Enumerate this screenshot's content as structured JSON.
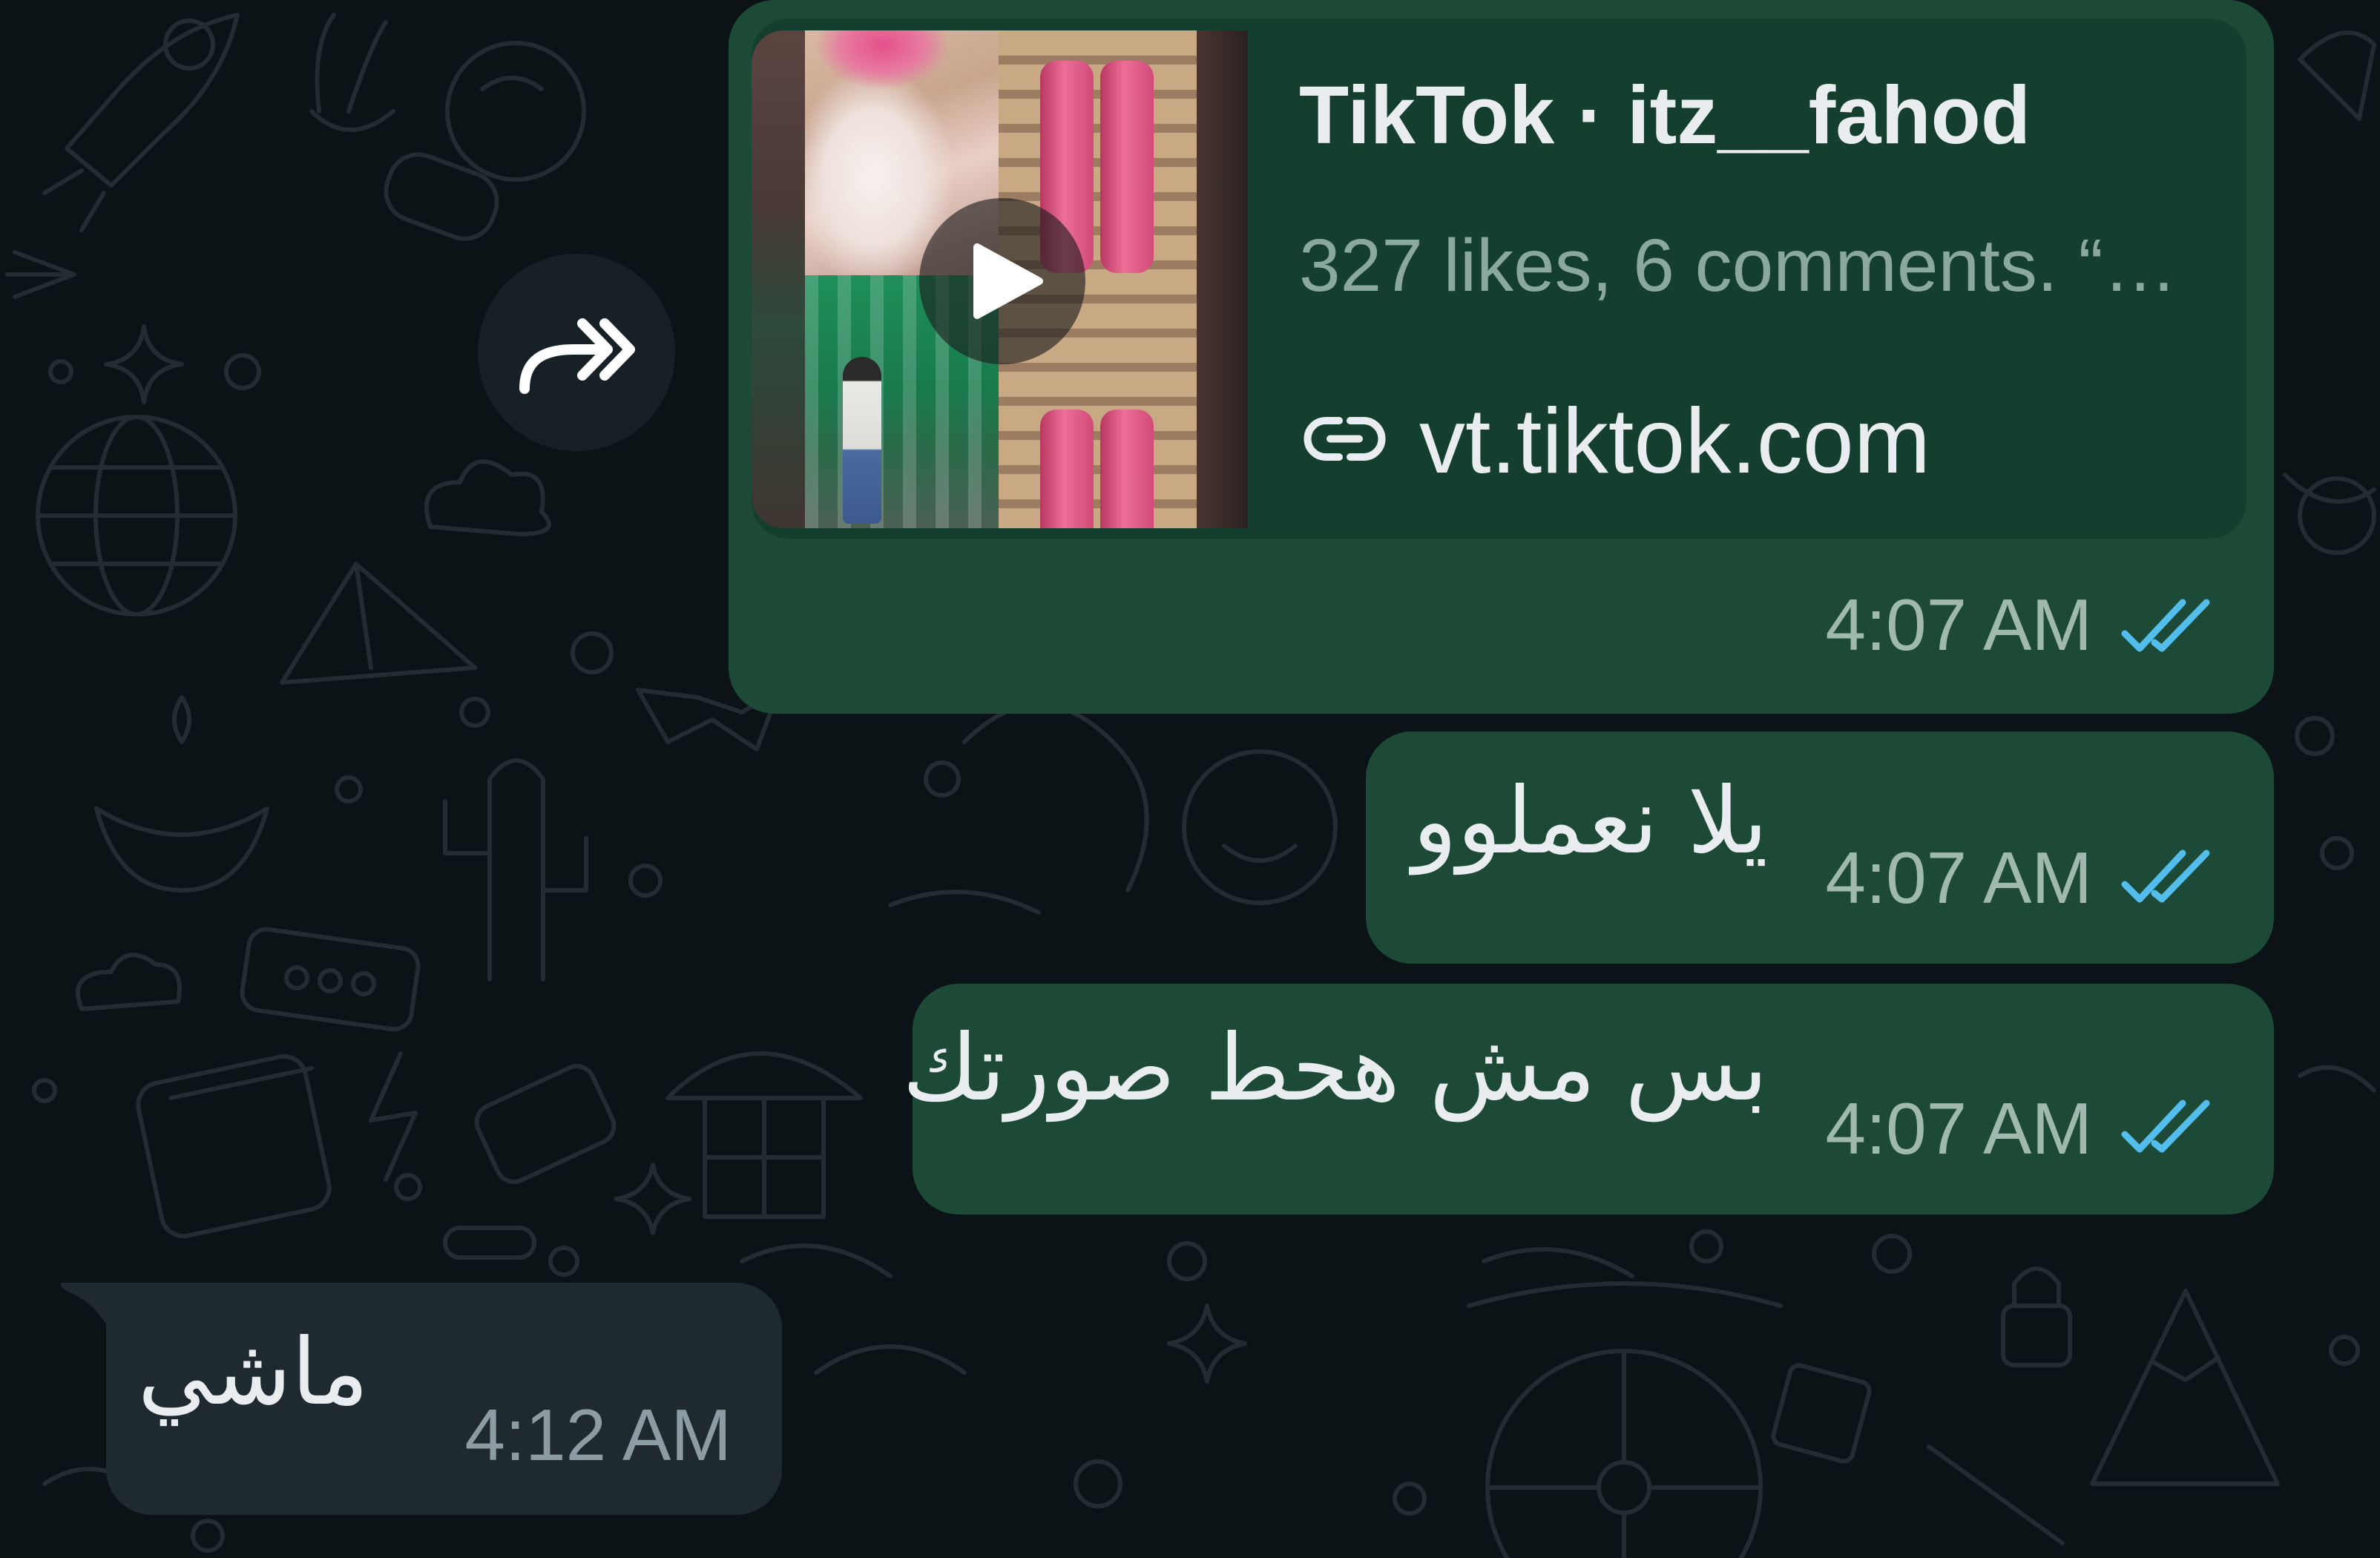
{
  "colors": {
    "background": "#0c1317",
    "wallpaper_doodle": "#232c31",
    "outgoing_bubble": "#1c4a37",
    "link_card": "#143e2e",
    "incoming_bubble": "#1f2a30",
    "primary_text": "#e9edef",
    "read_receipt": "#53bdeb",
    "forward_button": "#172024"
  },
  "forward_button": {
    "icon": "forward-icon"
  },
  "chat": {
    "messages": [
      {
        "outgoing": true,
        "link_preview": {
          "title": "TikTok · itz__fahod",
          "description": "327 likes, 6 comments. “…",
          "domain": "vt.tiktok.com",
          "link_icon": "link-icon",
          "play_icon": "play-icon"
        },
        "time": "4:07 AM",
        "status_icon": "double-check-icon"
      },
      {
        "outgoing": true,
        "text": "يلا نعملوو",
        "time": "4:07 AM",
        "status_icon": "double-check-icon"
      },
      {
        "outgoing": true,
        "text": "بس مش هحط صورتك",
        "time": "4:07 AM",
        "status_icon": "double-check-icon"
      },
      {
        "outgoing": false,
        "text": "ماشي",
        "time": "4:12 AM"
      }
    ]
  }
}
